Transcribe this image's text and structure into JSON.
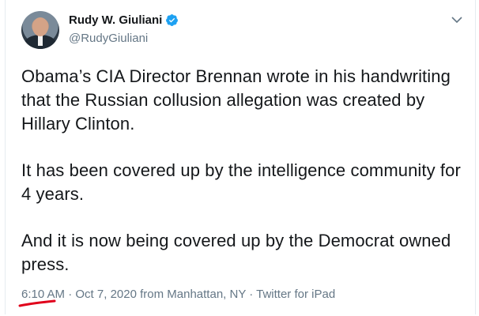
{
  "tweet": {
    "author": {
      "display_name": "Rudy W. Giuliani",
      "handle": "@RudyGiuliani",
      "verified": true,
      "avatar_icon": "profile-photo"
    },
    "paragraphs": [
      "Obama’s CIA Director Brennan wrote in his handwriting that the Russian collusion allegation was created by Hillary Clinton.",
      "It has been covered up by the intelligence community for 4 years.",
      "And it is now being covered up by the Democrat owned press."
    ],
    "meta": {
      "time": "6:10 AM",
      "sep1": " · ",
      "date_location": "Oct 7, 2020 from Manhattan, NY",
      "sep2": " · ",
      "source": "Twitter for iPad"
    },
    "menu_icon": "chevron-down-icon",
    "annotation_color": "#e0001b",
    "accent_color": "#1da1f2"
  }
}
